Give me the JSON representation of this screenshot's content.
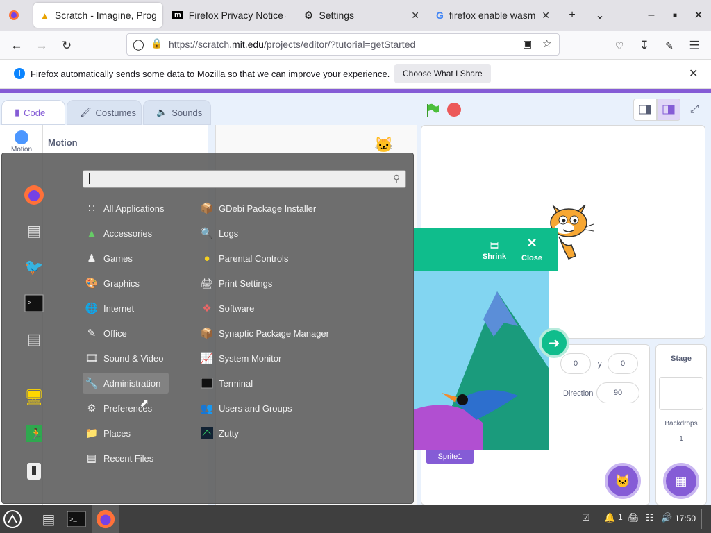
{
  "browser": {
    "tabs": [
      {
        "title": "Scratch - Imagine, Prog",
        "active": true
      },
      {
        "title": "Firefox Privacy Notice —",
        "active": false
      },
      {
        "title": "Settings",
        "active": false
      },
      {
        "title": "firefox enable wasm - G",
        "active": false
      }
    ],
    "url_prefix": "https://scratch.",
    "url_domain": "mit.edu",
    "url_suffix": "/projects/editor/?tutorial=getStarted"
  },
  "notification": {
    "message": "Firefox automatically sends some data to Mozilla so that we can improve your experience.",
    "button": "Choose What I Share"
  },
  "scratch": {
    "tabs": [
      "Code",
      "Costumes",
      "Sounds"
    ],
    "category": "Motion",
    "category_title": "Motion",
    "tutorial": {
      "shrink": "Shrink",
      "close": "Close"
    },
    "sprite": {
      "x": "0",
      "y": "0",
      "direction_label": "Direction",
      "direction": "90",
      "name": "Sprite1",
      "y_label": "y"
    },
    "stage": {
      "title": "Stage",
      "backdrops_label": "Backdrops",
      "backdrops_count": "1"
    },
    "accent": "#855cd6"
  },
  "menu": {
    "search_value": "",
    "categories": [
      "All Applications",
      "Accessories",
      "Games",
      "Graphics",
      "Internet",
      "Office",
      "Sound & Video",
      "Administration",
      "Preferences",
      "Places",
      "Recent Files"
    ],
    "apps": [
      "GDebi Package Installer",
      "Logs",
      "Parental Controls",
      "Print Settings",
      "Software",
      "Synaptic Package Manager",
      "System Monitor",
      "Terminal",
      "Users and Groups",
      "Zutty"
    ],
    "selected": "Administration"
  },
  "taskbar": {
    "clock": "17:50",
    "notif_count": "1"
  }
}
